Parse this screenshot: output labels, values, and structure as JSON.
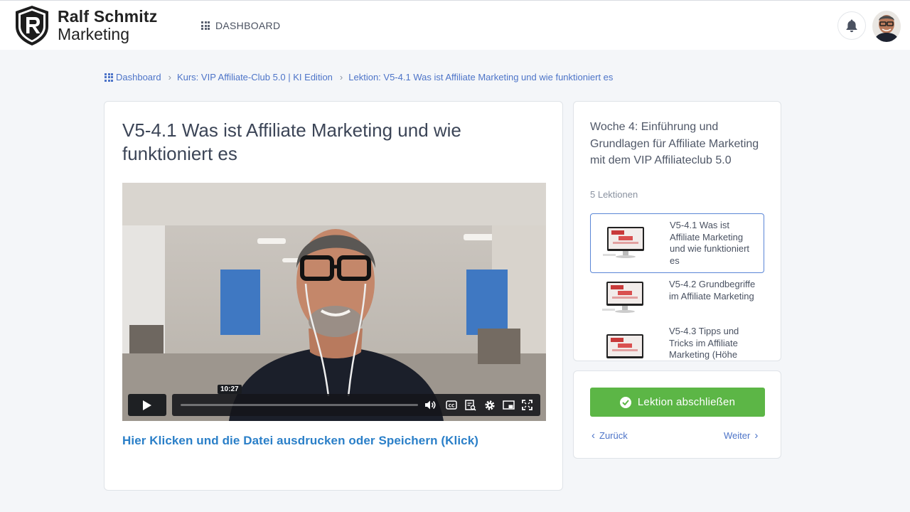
{
  "header": {
    "logo_line1": "Ralf Schmitz",
    "logo_line2": "Marketing",
    "nav_dashboard": "DASHBOARD",
    "bell_icon": "bell-icon",
    "avatar": "user-avatar"
  },
  "breadcrumb": {
    "items": [
      "Dashboard",
      "Kurs: VIP Affiliate-Club 5.0 | KI Edition",
      "Lektion: V5-4.1 Was ist Affiliate Marketing und wie funktioniert es"
    ]
  },
  "lesson": {
    "title": "V5-4.1 Was ist Affiliate Marketing und wie funktioniert es",
    "video": {
      "time_tooltip": "10:27",
      "progress": 0
    },
    "download_link": "Hier Klicken und die Datei ausdrucken oder Speichern (Klick)"
  },
  "sidebar": {
    "week_title": "Woche 4: Einführung und Grundlagen für Affiliate Marketing mit dem VIP Affiliateclub 5.0",
    "lesson_count": "5 Lektionen",
    "lessons": [
      {
        "label": "V5-4.1 Was ist Affiliate Marketing und wie funktioniert es",
        "active": true
      },
      {
        "label": "V5-4.2 Grundbegriffe im Affiliate Marketing",
        "active": false
      },
      {
        "label": "V5-4.3 Tipps und Tricks im Affiliate Marketing (Höhe",
        "active": false
      }
    ]
  },
  "navigation": {
    "complete_label": "Lektion abschließen",
    "back_label": "Zurück",
    "next_label": "Weiter"
  },
  "colors": {
    "accent": "#4d74c8",
    "link": "#2a7fc8",
    "complete": "#5cb646"
  }
}
